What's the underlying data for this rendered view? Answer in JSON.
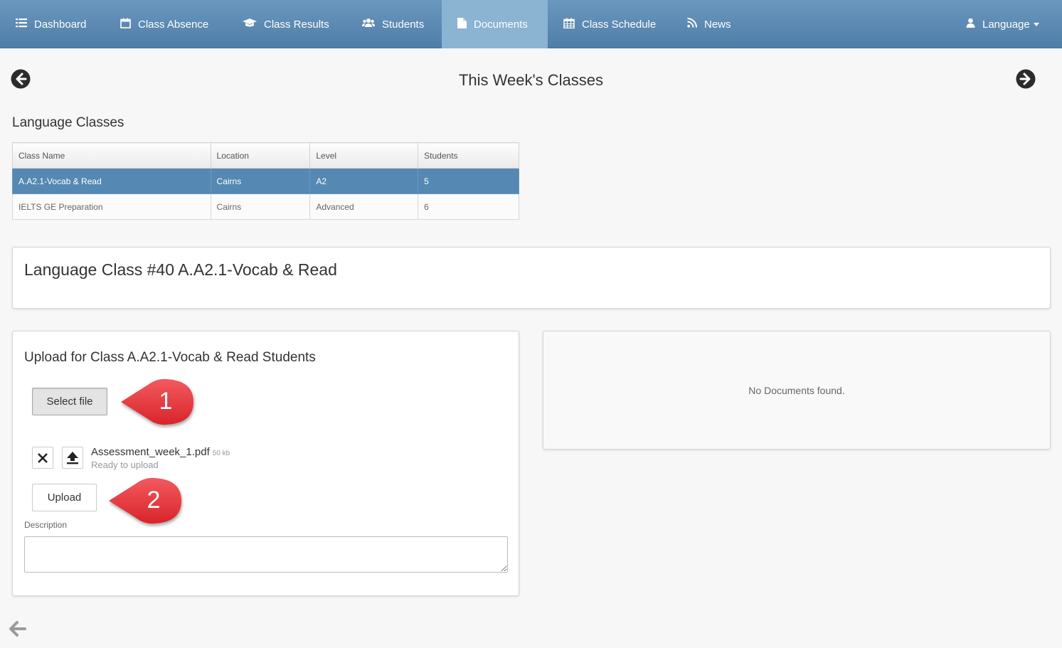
{
  "nav": {
    "items": [
      {
        "label": "Dashboard",
        "icon": "bars-icon"
      },
      {
        "label": "Class Absence",
        "icon": "calendar-icon"
      },
      {
        "label": "Class Results",
        "icon": "graduation-cap-icon"
      },
      {
        "label": "Students",
        "icon": "users-icon"
      },
      {
        "label": "Documents",
        "icon": "document-icon",
        "active": true
      },
      {
        "label": "Class Schedule",
        "icon": "calendar-grid-icon"
      },
      {
        "label": "News",
        "icon": "rss-icon"
      }
    ],
    "language": {
      "label": "Language",
      "icon": "user-icon"
    }
  },
  "page": {
    "title": "This Week's Classes"
  },
  "classes": {
    "title": "Language Classes",
    "columns": [
      "Class Name",
      "Location",
      "Level",
      "Students"
    ],
    "rows": [
      [
        "A.A2.1-Vocab & Read",
        "Cairns",
        "A2",
        "5"
      ],
      [
        "IELTS GE Preparation",
        "Cairns",
        "Advanced",
        "6"
      ]
    ],
    "selected_row": 0
  },
  "class_panel": {
    "title": "Language Class #40 A.A2.1-Vocab & Read"
  },
  "upload": {
    "title": "Upload for Class A.A2.1-Vocab & Read Students",
    "select_label": "Select file",
    "file": {
      "name": "Assessment_week_1.pdf",
      "size": "50 kb",
      "status": "Ready to upload"
    },
    "upload_label": "Upload",
    "description_label": "Description",
    "description_value": ""
  },
  "documents": {
    "empty_text": "No Documents found."
  },
  "callouts": [
    "1",
    "2"
  ],
  "colors": {
    "nav_bg": "#5f8db5",
    "nav_active": "#8bb3d2",
    "row_selected": "#5588b2",
    "callout_red": "#e8333a"
  }
}
